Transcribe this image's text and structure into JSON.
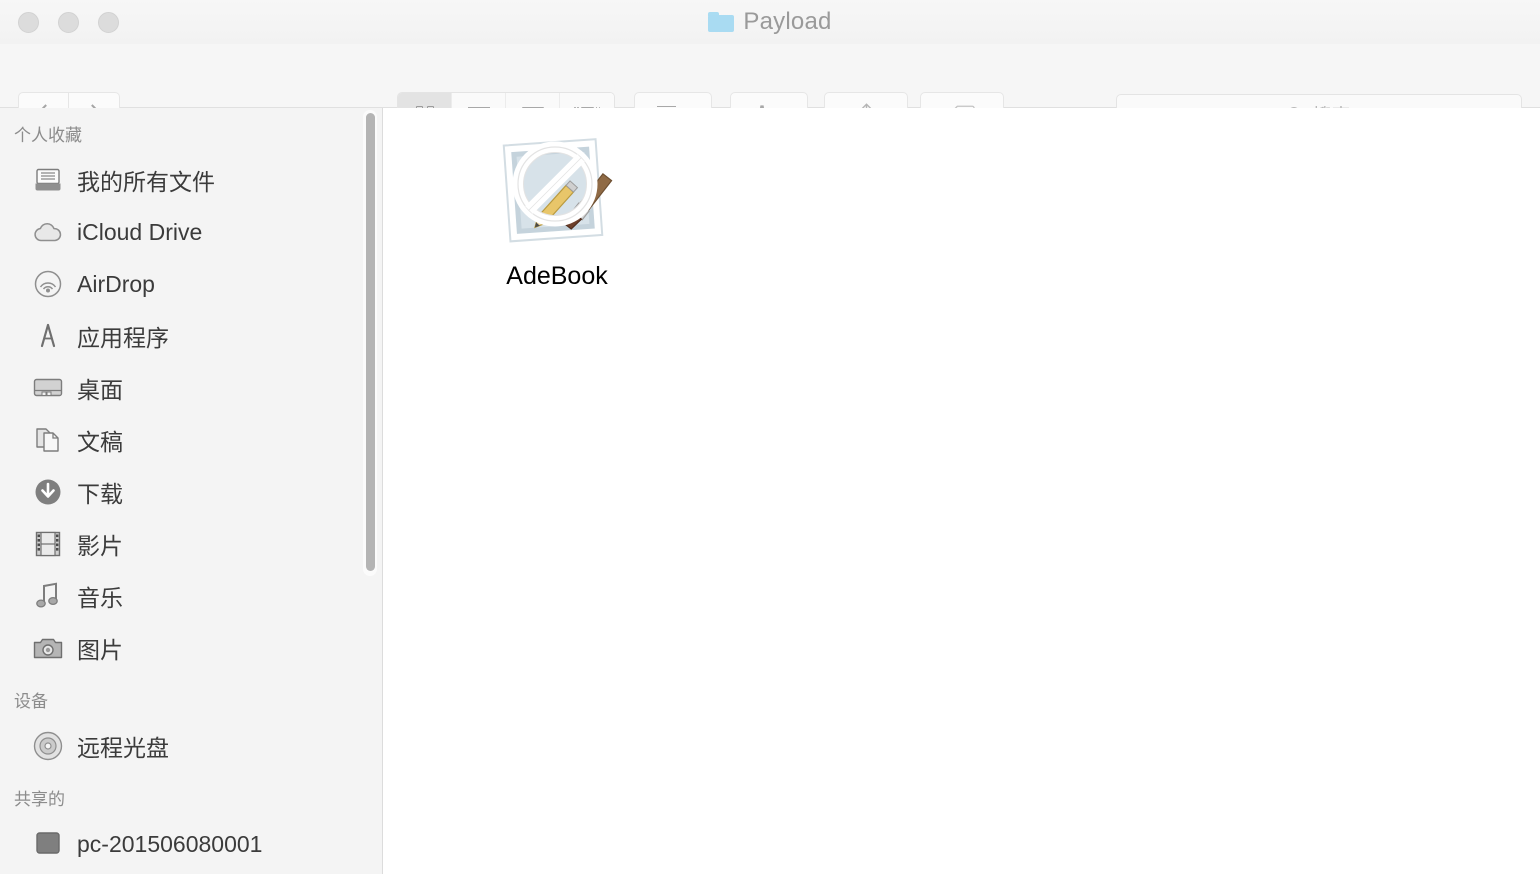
{
  "window": {
    "title": "Payload",
    "title_icon": "folder-icon",
    "traffic_lights": [
      {
        "name": "close-button",
        "color": "#dcdcdc"
      },
      {
        "name": "minimize-button",
        "color": "#dcdcdc"
      },
      {
        "name": "zoom-button",
        "color": "#dcdcdc"
      }
    ]
  },
  "toolbar": {
    "back_icon": "chevron-left-icon",
    "forward_icon": "chevron-right-icon",
    "view_modes": [
      {
        "name": "icon-view",
        "icon": "grid-icon",
        "selected": true
      },
      {
        "name": "list-view",
        "icon": "list-icon",
        "selected": false
      },
      {
        "name": "column-view",
        "icon": "columns-icon",
        "selected": false
      },
      {
        "name": "coverflow-view",
        "icon": "coverflow-icon",
        "selected": false
      }
    ],
    "arrange_icon": "arrange-grid-icon",
    "action_icon": "gear-icon",
    "share_icon": "share-icon",
    "tags_icon": "tag-icon",
    "dropdown_icon": "chevron-down-icon"
  },
  "search": {
    "icon": "search-icon",
    "placeholder": "搜索",
    "value": ""
  },
  "sidebar": {
    "sections": [
      {
        "name": "favorites",
        "title": "个人收藏",
        "items": [
          {
            "label": "我的所有文件",
            "icon": "all-my-files-icon"
          },
          {
            "label": "iCloud Drive",
            "icon": "cloud-icon"
          },
          {
            "label": "AirDrop",
            "icon": "airdrop-icon"
          },
          {
            "label": "应用程序",
            "icon": "applications-icon"
          },
          {
            "label": "桌面",
            "icon": "desktop-icon"
          },
          {
            "label": "文稿",
            "icon": "documents-icon"
          },
          {
            "label": "下载",
            "icon": "downloads-icon"
          },
          {
            "label": "影片",
            "icon": "movies-icon"
          },
          {
            "label": "音乐",
            "icon": "music-icon"
          },
          {
            "label": "图片",
            "icon": "pictures-icon"
          }
        ]
      },
      {
        "name": "devices",
        "title": "设备",
        "items": [
          {
            "label": "远程光盘",
            "icon": "disc-icon"
          }
        ]
      },
      {
        "name": "shared",
        "title": "共享的",
        "items": [
          {
            "label": "pc-201506080001",
            "icon": "display-icon"
          }
        ]
      }
    ],
    "scrollbar": {
      "name": "sidebar-scrollbar"
    }
  },
  "content": {
    "files": [
      {
        "label": "AdeBook",
        "icon": "prohibited-app-icon",
        "selected": false
      }
    ]
  },
  "colors": {
    "toolbar_bg": "#f6f6f6",
    "sidebar_bg": "#f4f4f4",
    "content_bg": "#ffffff",
    "folder_blue": "#a9dbf2",
    "sidebar_label": "#3b3b3b",
    "section_label": "#8c8c8c",
    "title_gray": "#9a9a9a"
  }
}
